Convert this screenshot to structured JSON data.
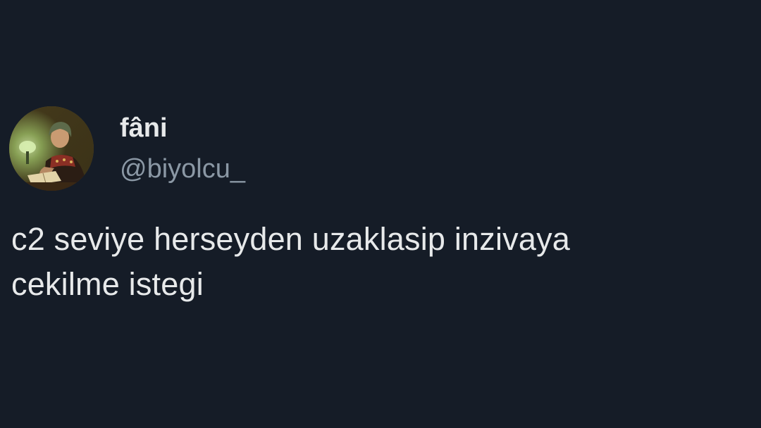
{
  "tweet": {
    "author": {
      "display_name": "fâni",
      "handle": "@biyolcu_",
      "avatar_icon": "profile-avatar"
    },
    "text_lines": [
      "c2 seviye herseyden uzaklasip inzivaya",
      "cekilme istegi"
    ]
  },
  "colors": {
    "background": "#151c27",
    "primary_text": "#e7e9ea",
    "secondary_text": "#8b98a5"
  }
}
